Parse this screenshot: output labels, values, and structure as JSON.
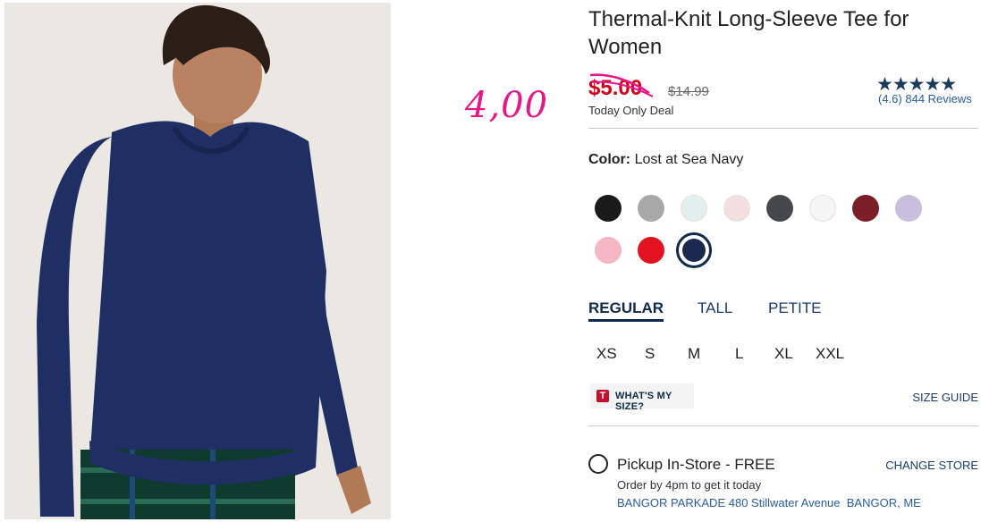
{
  "annotation": {
    "handwritten_price": "4,00"
  },
  "product": {
    "title": "Thermal-Knit Long-Sleeve Tee for Women",
    "sale_price": "$5.00",
    "original_price": "$14.99",
    "deal_label": "Today Only Deal",
    "rating": {
      "stars": "★★★★★",
      "score": "(4.6)",
      "reviews": "844 Reviews",
      "star_color": "#1b3a5c"
    }
  },
  "color": {
    "label": "Color:",
    "value": "Lost at Sea Navy",
    "swatches": [
      {
        "name": "Black",
        "hex": "#1a1a1a"
      },
      {
        "name": "Heather Gray",
        "hex": "#a8a8a8"
      },
      {
        "name": "Mint",
        "hex": "#e3efec"
      },
      {
        "name": "Blush",
        "hex": "#f3dfde"
      },
      {
        "name": "Charcoal",
        "hex": "#45474a"
      },
      {
        "name": "White",
        "hex": "#f5f5f5"
      },
      {
        "name": "Burgundy",
        "hex": "#7a1f28"
      },
      {
        "name": "Lavender",
        "hex": "#c9bede"
      },
      {
        "name": "Pink",
        "hex": "#f5b6c6"
      },
      {
        "name": "Red",
        "hex": "#e3141f"
      },
      {
        "name": "Lost at Sea Navy",
        "hex": "#1b2950",
        "selected": true
      }
    ]
  },
  "fit_tabs": [
    "REGULAR",
    "TALL",
    "PETITE"
  ],
  "sizes": [
    "XS",
    "S",
    "M",
    "L",
    "XL",
    "XXL"
  ],
  "whats_my_size": "WHAT'S MY SIZE?",
  "size_guide": "SIZE GUIDE",
  "pickup": {
    "label": "Pickup In-Store - FREE",
    "change_store": "CHANGE STORE",
    "order_note": "Order by 4pm to get it today",
    "store": "BANGOR PARKADE 480 Stillwater Avenue",
    "city": "BANGOR, ME"
  },
  "colors": {
    "sale_red": "#d0021b",
    "brand_navy": "#0f2a4a",
    "link_blue": "#2a5d9f",
    "annotation_pink": "#e8168a"
  }
}
